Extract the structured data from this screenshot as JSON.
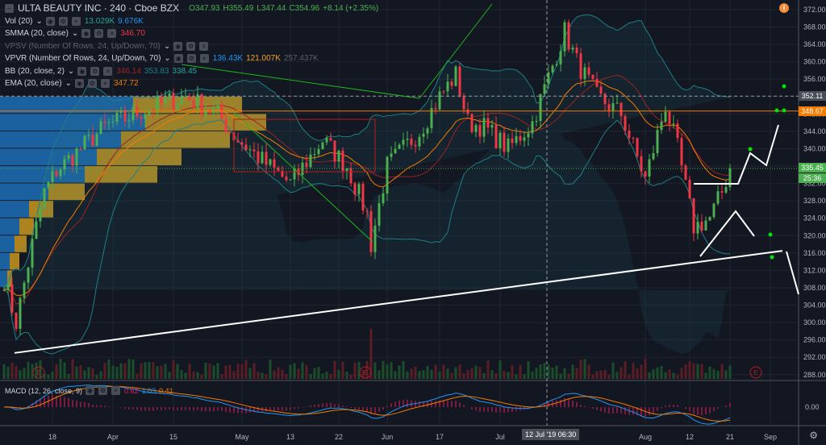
{
  "header": {
    "symbol": "ULTA BEAUTY INC · 240 · Cboe BZX",
    "open": "O347.93",
    "high": "H355.49",
    "low": "L347.44",
    "close": "C354.96",
    "change": "+8.14 (+2.35%)"
  },
  "indicators": [
    {
      "name": "Vol (20)",
      "values": [
        {
          "v": "13.029K",
          "c": "#26a69a"
        },
        {
          "v": "9.676K",
          "c": "#2196f3"
        }
      ]
    },
    {
      "name": "SMMA (20, close)",
      "values": [
        {
          "v": "346.70",
          "c": "#f23645"
        }
      ]
    },
    {
      "name": "VPSV (Number Of Rows, 24, Up/Down, 70)",
      "values": []
    },
    {
      "name": "VPVR (Number Of Rows, 24, Up/Down, 70)",
      "values": [
        {
          "v": "136.43K",
          "c": "#2196f3"
        },
        {
          "v": "121.007K",
          "c": "#f5a623"
        },
        {
          "v": "257.437K",
          "c": "#5d606b"
        }
      ]
    },
    {
      "name": "BB (20, close, 2)",
      "values": [
        {
          "v": "346.14",
          "c": "#9b2226"
        },
        {
          "v": "353.83",
          "c": "#1e7f86"
        },
        {
          "v": "338.45",
          "c": "#26a69a"
        }
      ]
    },
    {
      "name": "EMA (20, close)",
      "values": [
        {
          "v": "347.72",
          "c": "#f57c00"
        }
      ]
    }
  ],
  "macd": {
    "name": "MACD (12, 26, close, 9)",
    "values": [
      {
        "v": "0.62",
        "c": "#e91e63"
      },
      {
        "v": "1.03",
        "c": "#2196f3"
      },
      {
        "v": "0.41",
        "c": "#f57c00"
      }
    ],
    "zero_label": "0.00"
  },
  "price_tags": {
    "crosshair": "352.11",
    "orange_line": "348.67",
    "last": "335.45",
    "countdown": "25:36"
  },
  "crosshair_time": "12 Jul '19  06:30",
  "colors": {
    "up": "#4caf50",
    "down": "#f23645",
    "bg": "#131722"
  },
  "chart_data": {
    "type": "candlestick",
    "title": "ULTA BEAUTY INC, 240, Cboe BZX",
    "ylim": [
      286,
      374
    ],
    "yticks": [
      288,
      292,
      296,
      300,
      304,
      308,
      312,
      316,
      320,
      324,
      328,
      332,
      336,
      340,
      344,
      348,
      352,
      356,
      360,
      364,
      368,
      372
    ],
    "xtick_labels": [
      {
        "bar": 12,
        "label": "18"
      },
      {
        "bar": 27,
        "label": "Apr"
      },
      {
        "bar": 42,
        "label": "15"
      },
      {
        "bar": 59,
        "label": "May"
      },
      {
        "bar": 71,
        "label": "13"
      },
      {
        "bar": 83,
        "label": "22"
      },
      {
        "bar": 95,
        "label": "Jun"
      },
      {
        "bar": 108,
        "label": "17"
      },
      {
        "bar": 123,
        "label": "Jul"
      },
      {
        "bar": 159,
        "label": "Aug"
      },
      {
        "bar": 170,
        "label": "12"
      },
      {
        "bar": 180,
        "label": "21"
      },
      {
        "bar": 190,
        "label": "Sep"
      }
    ],
    "close_keypoints": [
      [
        0,
        310
      ],
      [
        3,
        300
      ],
      [
        7,
        318
      ],
      [
        10,
        330
      ],
      [
        13,
        335
      ],
      [
        19,
        340
      ],
      [
        25,
        345
      ],
      [
        35,
        349
      ],
      [
        45,
        352
      ],
      [
        53,
        348
      ],
      [
        57,
        343
      ],
      [
        63,
        338
      ],
      [
        71,
        332
      ],
      [
        79,
        342
      ],
      [
        85,
        336
      ],
      [
        90,
        325
      ],
      [
        91,
        318
      ],
      [
        95,
        336
      ],
      [
        103,
        344
      ],
      [
        108,
        352
      ],
      [
        112,
        357
      ],
      [
        115,
        346
      ],
      [
        119,
        345
      ],
      [
        125,
        340
      ],
      [
        131,
        346
      ],
      [
        139,
        367
      ],
      [
        142,
        360
      ],
      [
        147,
        352
      ],
      [
        153,
        348
      ],
      [
        159,
        333
      ],
      [
        164,
        350
      ],
      [
        167,
        340
      ],
      [
        171,
        322
      ],
      [
        175,
        324
      ],
      [
        178,
        330
      ],
      [
        180,
        335.45
      ]
    ],
    "horizontal_levels": [
      352.11,
      348.67,
      335.45
    ],
    "volume_profile": [
      [
        350,
        0.55,
        0.45
      ],
      [
        346,
        0.6,
        0.5
      ],
      [
        342,
        0.5,
        0.45
      ],
      [
        338,
        0.4,
        0.35
      ],
      [
        334,
        0.35,
        0.3
      ],
      [
        330,
        0.2,
        0.15
      ],
      [
        326,
        0.12,
        0.1
      ],
      [
        322,
        0.08,
        0.06
      ],
      [
        318,
        0.06,
        0.05
      ],
      [
        314,
        0.04,
        0.04
      ],
      [
        310,
        0.03,
        0.02
      ]
    ],
    "trendline": [
      [
        0,
        293
      ],
      [
        193,
        316.5
      ]
    ]
  }
}
